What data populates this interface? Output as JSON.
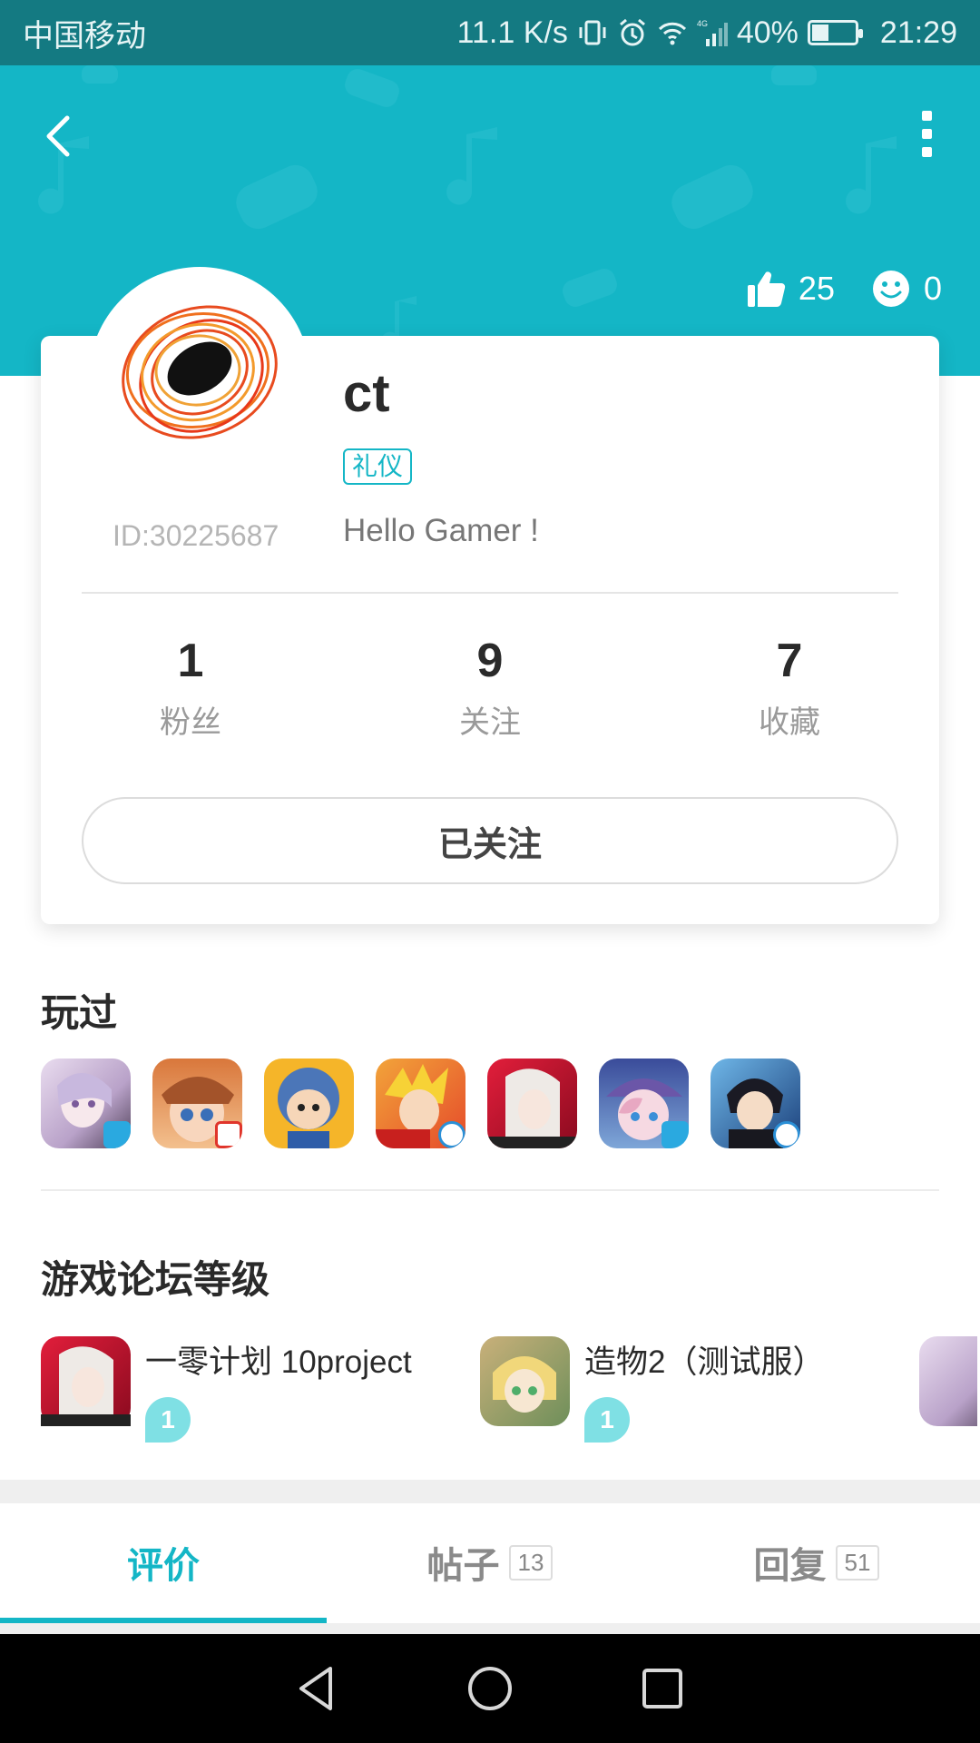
{
  "status_bar": {
    "carrier": "中国移动",
    "speed": "11.1 K/s",
    "network": "4G",
    "battery": "40%",
    "battery_level": 0.4,
    "time": "21:29"
  },
  "header": {
    "likes": "25",
    "smiles": "0",
    "accent_color": "#14b6c6"
  },
  "profile": {
    "username": "ct",
    "badge": "礼仪",
    "user_id": "ID:30225687",
    "bio": "Hello Gamer !"
  },
  "counts": [
    {
      "value": "1",
      "label": "粉丝"
    },
    {
      "value": "9",
      "label": "关注"
    },
    {
      "value": "7",
      "label": "收藏"
    }
  ],
  "follow_button": "已关注",
  "played": {
    "title": "玩过",
    "icons": [
      "game-icon-1",
      "game-icon-2",
      "game-icon-3",
      "game-icon-4",
      "game-icon-5",
      "game-icon-6",
      "game-icon-7"
    ]
  },
  "forum": {
    "title": "游戏论坛等级",
    "items": [
      {
        "name": "一零计划 10project",
        "level": "1"
      },
      {
        "name": "造物2（测试服）",
        "level": "1"
      }
    ]
  },
  "tabs": [
    {
      "label": "评价",
      "count": ""
    },
    {
      "label": "帖子",
      "count": "13"
    },
    {
      "label": "回复",
      "count": "51"
    }
  ]
}
